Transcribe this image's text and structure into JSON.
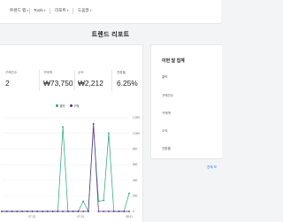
{
  "nav": {
    "items": [
      {
        "label": "트렌드 랩"
      },
      {
        "label": "Tools"
      },
      {
        "label": "리포트"
      },
      {
        "label": "도움말"
      }
    ]
  },
  "page": {
    "title": "트렌드 리포트"
  },
  "metrics": [
    {
      "label": "구매건수",
      "value": "2"
    },
    {
      "label": "구매액",
      "value": "₩73,750"
    },
    {
      "label": "수익",
      "value": "₩2,212"
    },
    {
      "label": "전환율",
      "value": "6.25%"
    }
  ],
  "side_panel": {
    "title": "이번 달 집계",
    "rows": [
      "클릭",
      "구매건수",
      "구매액",
      "수익",
      "전환율"
    ],
    "link": "전체 보"
  },
  "colors": {
    "clicks": "#22a37a",
    "purchases": "#5b2a86",
    "link": "#1f6feb"
  },
  "chart_data": {
    "type": "line",
    "legend_position": "top-center",
    "x": [
      "",
      "",
      "",
      "",
      "",
      "07.22",
      "",
      "",
      "",
      "",
      "",
      "",
      "",
      "07.31",
      "",
      "",
      "",
      "",
      "",
      "",
      "",
      "08.11"
    ],
    "y_right_ticks": [
      "0",
      "200",
      "400",
      "600",
      "800",
      "1,000",
      "1,200"
    ],
    "ylim": [
      0,
      1200
    ],
    "series": [
      {
        "name": "클릭",
        "values": [
          0,
          0,
          0,
          0,
          0,
          0,
          0,
          0,
          0,
          0,
          0,
          0,
          1080,
          0,
          0,
          0,
          130,
          0,
          1080,
          130,
          140,
          1000,
          0,
          0,
          0,
          230
        ]
      },
      {
        "name": "구매",
        "values": [
          0,
          0,
          0,
          0,
          0,
          0,
          0,
          0,
          0,
          0,
          0,
          0,
          0,
          0,
          0,
          0,
          0,
          0,
          1120,
          0,
          0,
          0,
          0,
          0,
          0,
          0
        ]
      }
    ]
  }
}
